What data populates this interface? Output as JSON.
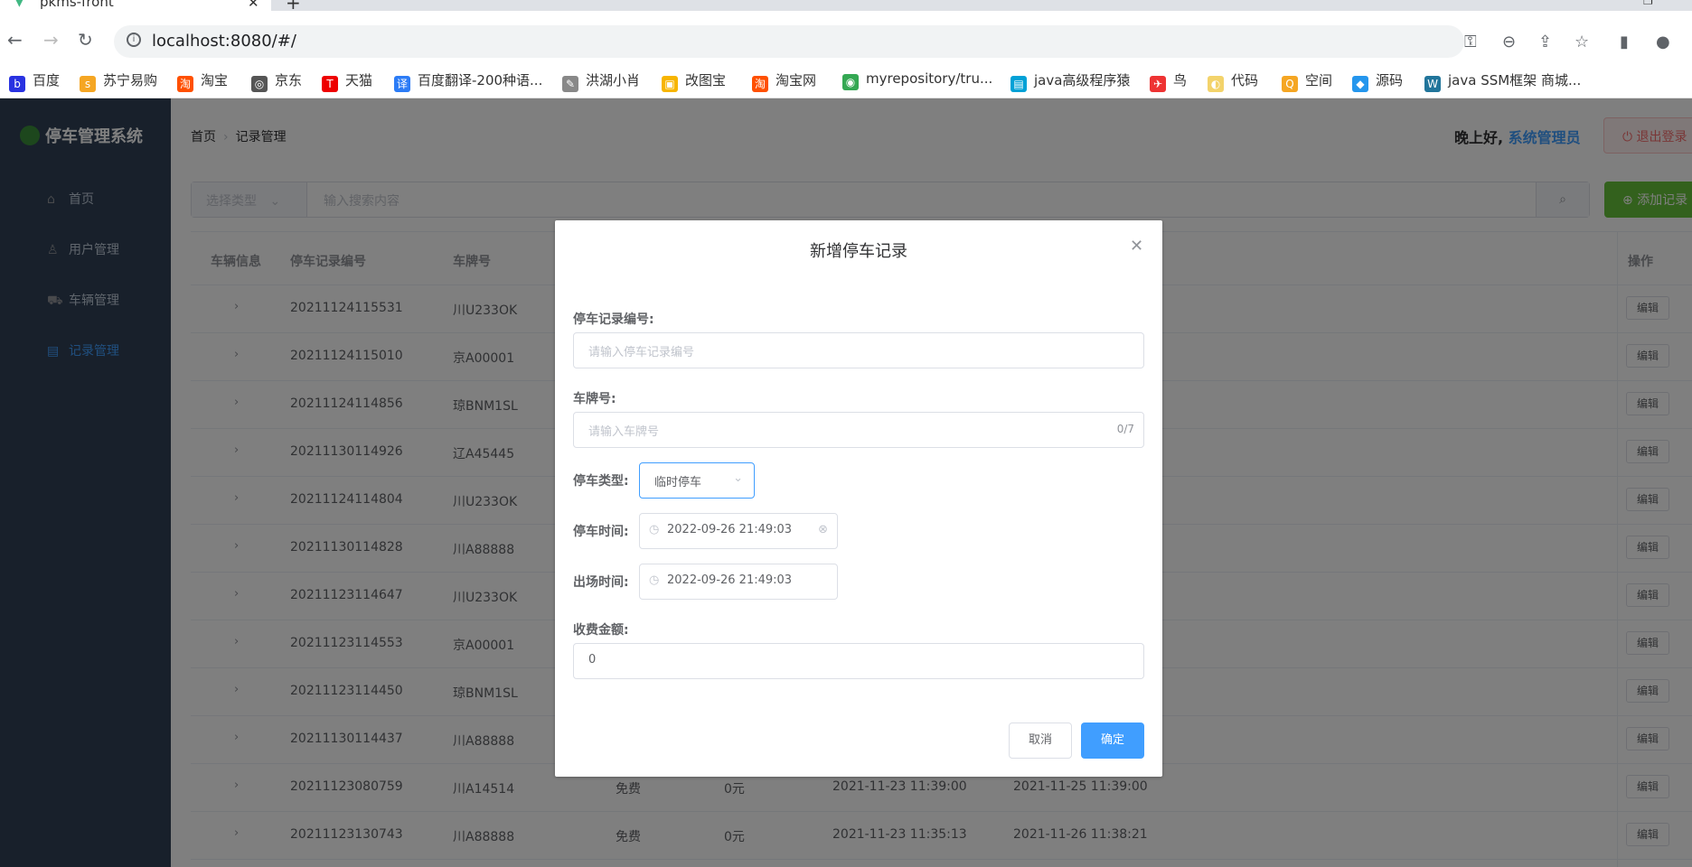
{
  "browser": {
    "tab_title": "pkms-front",
    "url": "localhost:8080/#/",
    "bookmarks": [
      "百度",
      "苏宁易购",
      "淘宝",
      "京东",
      "天猫",
      "百度翻译-200种语...",
      "洪湖小肖",
      "改图宝",
      "淘宝网",
      "myrepository/tru...",
      "java高级程序猿",
      "鸟",
      "代码",
      "空间",
      "源码",
      "java SSM框架 商城..."
    ]
  },
  "sidebar": {
    "logo": "停车管理系统",
    "items": [
      {
        "label": "首页",
        "icon": "home-icon"
      },
      {
        "label": "用户管理",
        "icon": "user-icon"
      },
      {
        "label": "车辆管理",
        "icon": "truck-icon"
      },
      {
        "label": "记录管理",
        "icon": "document-icon"
      }
    ]
  },
  "header": {
    "breadcrumb": [
      "首页",
      "记录管理"
    ],
    "greeting": "晚上好,",
    "admin": "系统管理员",
    "logout": "退出登录"
  },
  "search": {
    "type_placeholder": "选择类型",
    "query_placeholder": "输入搜索内容",
    "add_label": "添加记录"
  },
  "table": {
    "headers": [
      "车辆信息",
      "停车记录编号",
      "车牌号",
      "操作"
    ],
    "edit_label": "编辑",
    "rows": [
      {
        "id": "20211124115531",
        "plate": "川U233OK",
        "type": "",
        "fee": "",
        "in": "",
        "out": ""
      },
      {
        "id": "20211124115010",
        "plate": "京A00001",
        "type": "",
        "fee": "",
        "in": "",
        "out": ""
      },
      {
        "id": "20211124114856",
        "plate": "琼BNM1SL",
        "type": "",
        "fee": "",
        "in": "",
        "out": ""
      },
      {
        "id": "20211130114926",
        "plate": "辽A45445",
        "type": "",
        "fee": "",
        "in": "",
        "out": ""
      },
      {
        "id": "20211124114804",
        "plate": "川U233OK",
        "type": "",
        "fee": "",
        "in": "",
        "out": ""
      },
      {
        "id": "20211130114828",
        "plate": "川A88888",
        "type": "",
        "fee": "",
        "in": "",
        "out": ""
      },
      {
        "id": "20211123114647",
        "plate": "川U233OK",
        "type": "",
        "fee": "",
        "in": "",
        "out": ""
      },
      {
        "id": "20211123114553",
        "plate": "京A00001",
        "type": "",
        "fee": "",
        "in": "",
        "out": ""
      },
      {
        "id": "20211123114450",
        "plate": "琼BNM1SL",
        "type": "",
        "fee": "",
        "in": "",
        "out": ""
      },
      {
        "id": "20211130114437",
        "plate": "川A88888",
        "type": "",
        "fee": "",
        "in": "",
        "out": ""
      },
      {
        "id": "20211123080759",
        "plate": "川A14514",
        "type": "免费",
        "fee": "0元",
        "in": "2021-11-23 11:39:00",
        "out": "2021-11-25 11:39:00"
      },
      {
        "id": "20211123130743",
        "plate": "川A88888",
        "type": "免费",
        "fee": "0元",
        "in": "2021-11-23 11:35:13",
        "out": "2021-11-26 11:38:21"
      }
    ]
  },
  "dialog": {
    "title": "新增停车记录",
    "record_label": "停车记录编号:",
    "record_placeholder": "请输入停车记录编号",
    "plate_label": "车牌号:",
    "plate_placeholder": "请输入车牌号",
    "plate_count": "0/7",
    "type_label": "停车类型:",
    "type_value": "临时停车",
    "in_label": "停车时间:",
    "in_value": "2022-09-26 21:49:03",
    "out_label": "出场时间:",
    "out_value": "2022-09-26 21:49:03",
    "fee_label": "收费金额:",
    "fee_value": "0",
    "cancel": "取消",
    "confirm": "确定"
  }
}
